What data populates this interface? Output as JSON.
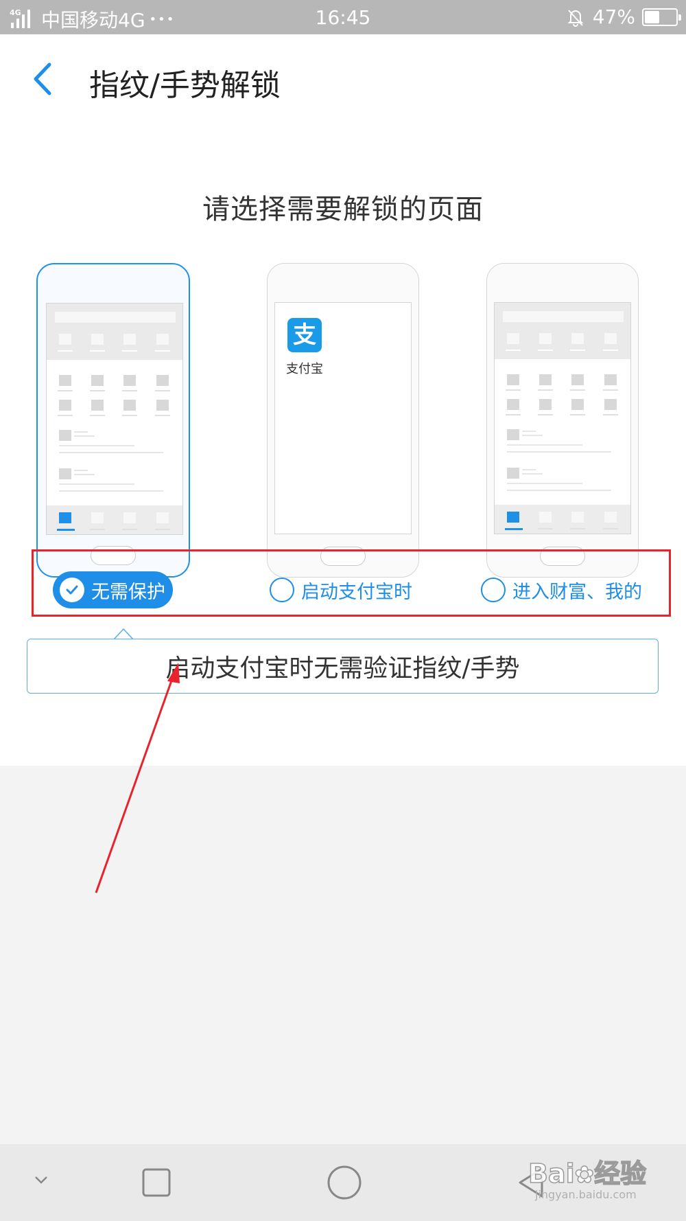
{
  "status_bar": {
    "network_tag": "4G",
    "carrier": "中国移动4G",
    "dots": "•••",
    "time": "16:45",
    "battery": "47%",
    "battery_level": 0.47,
    "icons": [
      "signal-icon",
      "bell-muted-icon",
      "battery-icon"
    ]
  },
  "header": {
    "title": "指纹/手势解锁",
    "back_icon": "chevron-left-icon"
  },
  "prompt": "请选择需要解锁的页面",
  "previews": {
    "middle_app_label": "支付宝",
    "middle_logo_glyph": "支"
  },
  "options": [
    {
      "label": "无需保护",
      "selected": true
    },
    {
      "label": "启动支付宝时",
      "selected": false
    },
    {
      "label": "进入财富、我的",
      "selected": false
    }
  ],
  "tooltip": "启动支付宝时无需验证指纹/手势",
  "nav_bar": {
    "icons": [
      "chevron-down-icon",
      "square-icon",
      "circle-icon",
      "back-triangle-icon"
    ]
  },
  "watermark": {
    "brand": "Bai",
    "brand_suffix": "经验",
    "url": "jingyan.baidu.com"
  },
  "colors": {
    "accent": "#1e8ee8",
    "annotation_red": "#e8232c"
  }
}
